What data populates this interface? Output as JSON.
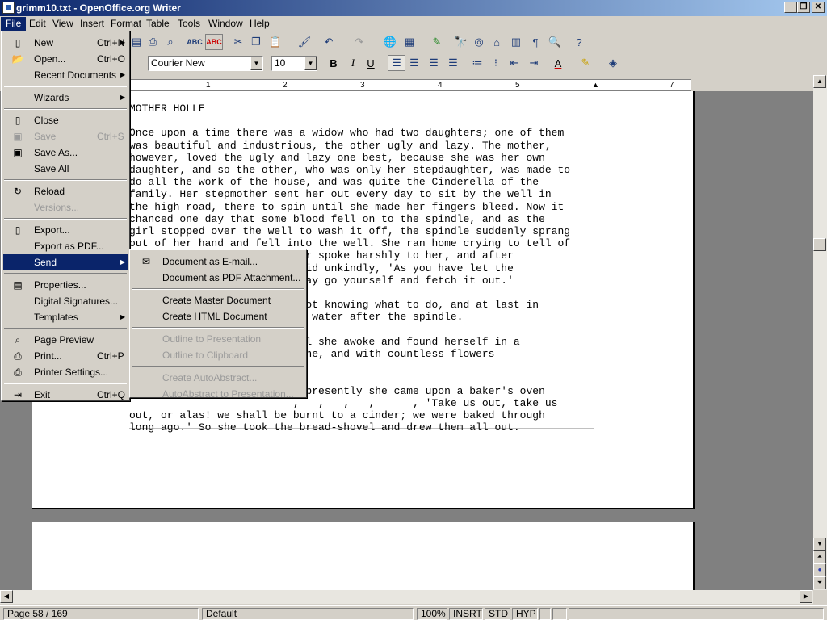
{
  "window": {
    "title": "grimm10.txt - OpenOffice.org Writer"
  },
  "menubar": {
    "items": [
      "File",
      "Edit",
      "View",
      "Insert",
      "Format",
      "Table",
      "Tools",
      "Window",
      "Help"
    ]
  },
  "format_bar": {
    "font_name": "Courier New",
    "font_size": "10"
  },
  "ruler": {
    "ticks": [
      "1",
      "2",
      "3",
      "4",
      "5",
      "7"
    ]
  },
  "document": {
    "lines": [
      "MOTHER HOLLE",
      "",
      "Once upon a time there was a widow who had two daughters; one of them",
      "was beautiful and industrious, the other ugly and lazy. The mother,",
      "however, loved the ugly and lazy one best, because she was her own",
      "daughter, and so the other, who was only her stepdaughter, was made to",
      "do all the work of the house, and was quite the Cinderella of the",
      "family. Her stepmother sent her out every day to sit by the well in",
      "the high road, there to spin until she made her fingers bleed. Now it",
      "chanced one day that some blood fell on to the spindle, and as the",
      "girl stopped over the well to wash it off, the spindle suddenly sprang",
      "out of her hand and fell into the well. She ran home crying to tell of",
      "                       mother spoke harshly to her, and after",
      "                       g, said unkindly, 'As you have let the",
      "                       you may go yourself and fetch it out.'",
      "",
      "                       ell not knowing what to do, and at last in",
      "                       o the water after the spindle.",
      "",
      "                        until she awoke and found herself in a",
      "                       unshine, and with countless flowers",
      "",
      "",
      "                        and presently she came upon a baker's oven",
      "                          ,   ,   ,   ,      , 'Take us out, take us",
      "out, or alas! we shall be burnt to a cinder; we were baked through",
      "long ago.' So she took the bread-shovel and drew them all out."
    ]
  },
  "file_menu": {
    "items": [
      {
        "label": "New",
        "shortcut": "Ctrl+N",
        "icon": "new-doc-icon",
        "arrow": true,
        "disabled": false
      },
      {
        "label": "Open...",
        "shortcut": "Ctrl+O",
        "icon": "open-folder-icon",
        "disabled": false
      },
      {
        "label": "Recent Documents",
        "arrow": true,
        "disabled": false
      },
      {
        "sep": true
      },
      {
        "label": "Wizards",
        "arrow": true,
        "disabled": false
      },
      {
        "sep": true
      },
      {
        "label": "Close",
        "icon": "close-doc-icon",
        "disabled": false
      },
      {
        "label": "Save",
        "shortcut": "Ctrl+S",
        "icon": "save-icon",
        "disabled": true
      },
      {
        "label": "Save As...",
        "icon": "save-as-icon",
        "disabled": false
      },
      {
        "label": "Save All",
        "disabled": false
      },
      {
        "sep": true
      },
      {
        "label": "Reload",
        "icon": "reload-icon",
        "disabled": false
      },
      {
        "label": "Versions...",
        "disabled": true
      },
      {
        "sep": true
      },
      {
        "label": "Export...",
        "icon": "export-icon",
        "disabled": false
      },
      {
        "label": "Export as PDF...",
        "disabled": false
      },
      {
        "label": "Send",
        "arrow": true,
        "selected": true,
        "disabled": false
      },
      {
        "sep": true
      },
      {
        "label": "Properties...",
        "icon": "properties-icon",
        "disabled": false
      },
      {
        "label": "Digital Signatures...",
        "disabled": false
      },
      {
        "label": "Templates",
        "arrow": true,
        "disabled": false
      },
      {
        "sep": true
      },
      {
        "label": "Page Preview",
        "icon": "page-preview-icon",
        "disabled": false
      },
      {
        "label": "Print...",
        "shortcut": "Ctrl+P",
        "icon": "print-icon",
        "disabled": false
      },
      {
        "label": "Printer Settings...",
        "icon": "printer-settings-icon",
        "disabled": false
      },
      {
        "sep": true
      },
      {
        "label": "Exit",
        "shortcut": "Ctrl+Q",
        "icon": "exit-icon",
        "disabled": false
      }
    ]
  },
  "send_menu": {
    "items": [
      {
        "label": "Document as E-mail...",
        "icon": "email-icon",
        "disabled": false
      },
      {
        "label": "Document as PDF Attachment...",
        "disabled": false
      },
      {
        "sep": true
      },
      {
        "label": "Create Master Document",
        "disabled": false
      },
      {
        "label": "Create HTML Document",
        "disabled": false
      },
      {
        "sep": true
      },
      {
        "label": "Outline to Presentation",
        "disabled": true
      },
      {
        "label": "Outline to Clipboard",
        "disabled": true
      },
      {
        "sep": true
      },
      {
        "label": "Create AutoAbstract...",
        "disabled": true
      },
      {
        "label": "AutoAbstract to Presentation...",
        "disabled": true
      }
    ]
  },
  "status": {
    "page": "Page 58 / 169",
    "style": "Default",
    "zoom": "100%",
    "insert_mode": "INSRT",
    "selection_mode": "STD",
    "hyphenation": "HYP"
  }
}
